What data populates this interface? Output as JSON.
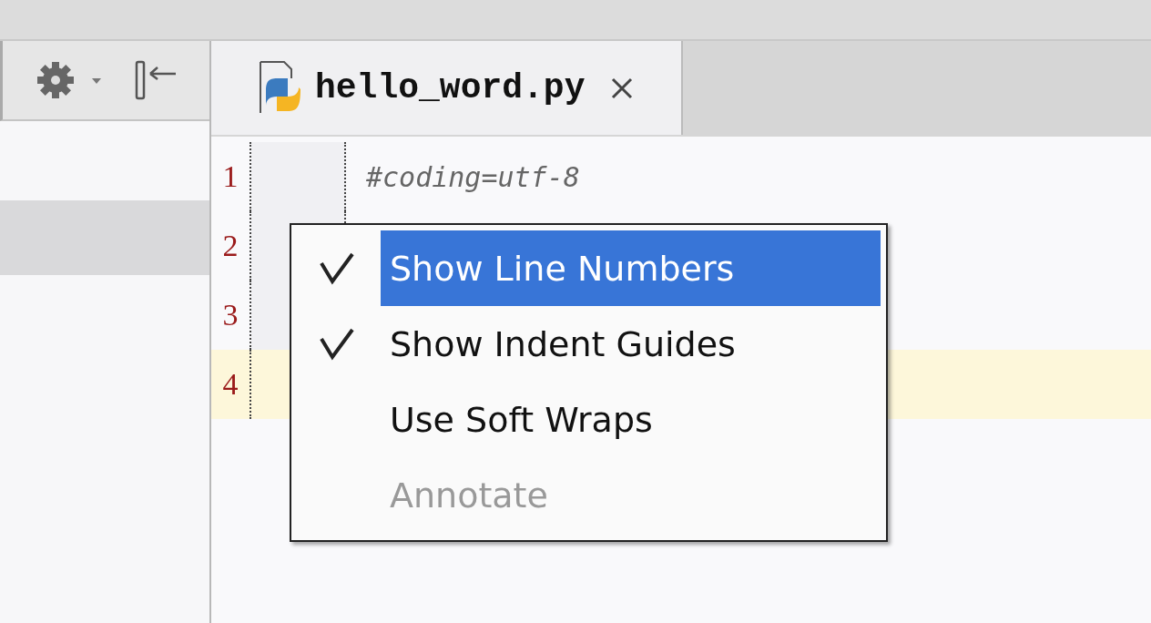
{
  "editor_tab": {
    "title": "hello_word.py",
    "selected": true
  },
  "lines": [
    {
      "number": "1",
      "code": "#coding=utf-8",
      "current": false
    },
    {
      "number": "2",
      "current": false
    },
    {
      "number": "3",
      "current": false
    },
    {
      "number": "4",
      "current": true
    }
  ],
  "context_menu": {
    "items": [
      {
        "label": "Show Line Numbers",
        "checked": true,
        "selected": true,
        "disabled": false
      },
      {
        "label": "Show Indent Guides",
        "checked": true,
        "selected": false,
        "disabled": false
      },
      {
        "label": "Use Soft Wraps",
        "checked": false,
        "selected": false,
        "disabled": false
      },
      {
        "label": "Annotate",
        "checked": false,
        "selected": false,
        "disabled": true
      }
    ]
  }
}
